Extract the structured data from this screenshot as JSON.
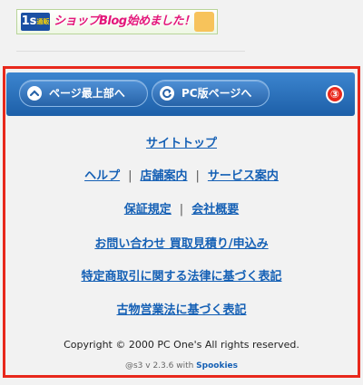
{
  "banner": {
    "logo": "1s",
    "logo_small": "通販",
    "text": "ショップBlog始めました！"
  },
  "nav": {
    "page_top_label": "ページ最上部へ",
    "pc_page_label": "PC版ページへ",
    "badge": "③"
  },
  "links": {
    "site_top": "サイトトップ",
    "help": "ヘルプ",
    "store_info": "店舗案内",
    "service_info": "サービス案内",
    "warranty": "保証規定",
    "company": "会社概要",
    "contact": "お問い合わせ 買取見積り/申込み",
    "tokutei": "特定商取引に関する法律に基づく表記",
    "kobutsu": "古物営業法に基づく表記",
    "separator": "|"
  },
  "footer": {
    "copyright": "Copyright © 2000 PC One's All rights reserved.",
    "version_prefix": "@s3 v 2.3.6 with ",
    "version_link": "Spookies"
  },
  "colors": {
    "link": "#1560b5",
    "nav_bar": "#1d5fa8",
    "frame": "#e8281c"
  }
}
